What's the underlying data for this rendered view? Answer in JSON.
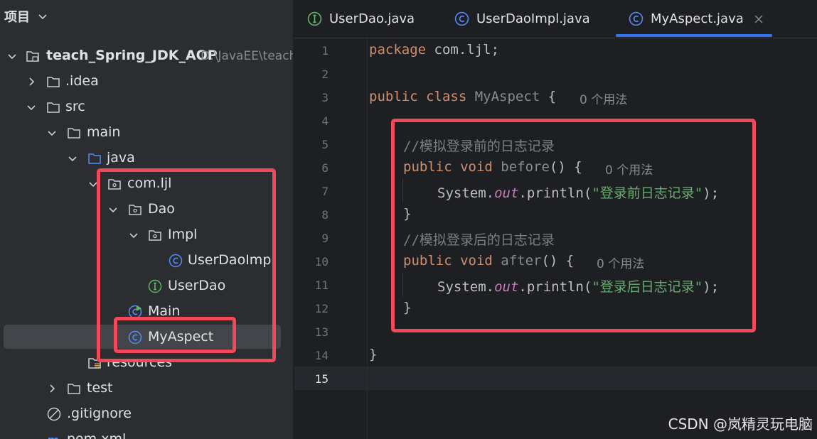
{
  "project_panel": {
    "title": "项目",
    "tree": [
      {
        "label": "teach_Spring_JDK_AOP",
        "path": "D:\\JavaEE\\teach",
        "expanded": true
      },
      {
        "label": ".idea",
        "expanded": false
      },
      {
        "label": "src",
        "expanded": true
      },
      {
        "label": "main",
        "expanded": true
      },
      {
        "label": "java",
        "expanded": true
      },
      {
        "label": "com.ljl",
        "expanded": true
      },
      {
        "label": "Dao",
        "expanded": true
      },
      {
        "label": "Impl",
        "expanded": true
      },
      {
        "label": "UserDaoImpl"
      },
      {
        "label": "UserDao"
      },
      {
        "label": "Main"
      },
      {
        "label": "MyAspect",
        "selected": true
      },
      {
        "label": "resources"
      },
      {
        "label": "test",
        "expanded": false
      },
      {
        "label": ".gitignore"
      },
      {
        "label": "pom.xml"
      }
    ]
  },
  "tabs": [
    {
      "label": "UserDao.java",
      "icon": "interface-icon"
    },
    {
      "label": "UserDaoImpl.java",
      "icon": "class-icon"
    },
    {
      "label": "MyAspect.java",
      "icon": "class-icon",
      "active": true
    }
  ],
  "editor": {
    "line_numbers": [
      "1",
      "2",
      "3",
      "4",
      "5",
      "6",
      "7",
      "8",
      "9",
      "10",
      "11",
      "12",
      "13",
      "14",
      "15"
    ],
    "lines": {
      "l1_kw": "package",
      "l1_rest": " com.ljl;",
      "l3_kw": "public class",
      "l3_name": " MyAspect",
      "l3_brace": " {",
      "l3_hint": "0 个用法",
      "l5_comment": "//模拟登录前的日志记录",
      "l6_kw": "public void",
      "l6_fn": " before",
      "l6_rest": "() {",
      "l6_hint": "0 个用法",
      "l7_a": "System.",
      "l7_out": "out",
      "l7_b": ".println(",
      "l7_str": "\"登录前日志记录\"",
      "l7_c": ");",
      "l8": "}",
      "l9_comment": "//模拟登录后的日志记录",
      "l10_kw": "public void",
      "l10_fn": " after",
      "l10_rest": "() {",
      "l10_hint": "0 个用法",
      "l11_a": "System.",
      "l11_out": "out",
      "l11_b": ".println(",
      "l11_str": "\"登录后日志记录\"",
      "l11_c": ");",
      "l12": "}",
      "l14": "}"
    }
  },
  "watermark": "CSDN @岚精灵玩电脑",
  "colors": {
    "highlight_box": "#f04a5a",
    "accent": "#3574f0",
    "keyword": "#cf8e6d",
    "string": "#6aab73",
    "comment": "#7a7e85"
  }
}
